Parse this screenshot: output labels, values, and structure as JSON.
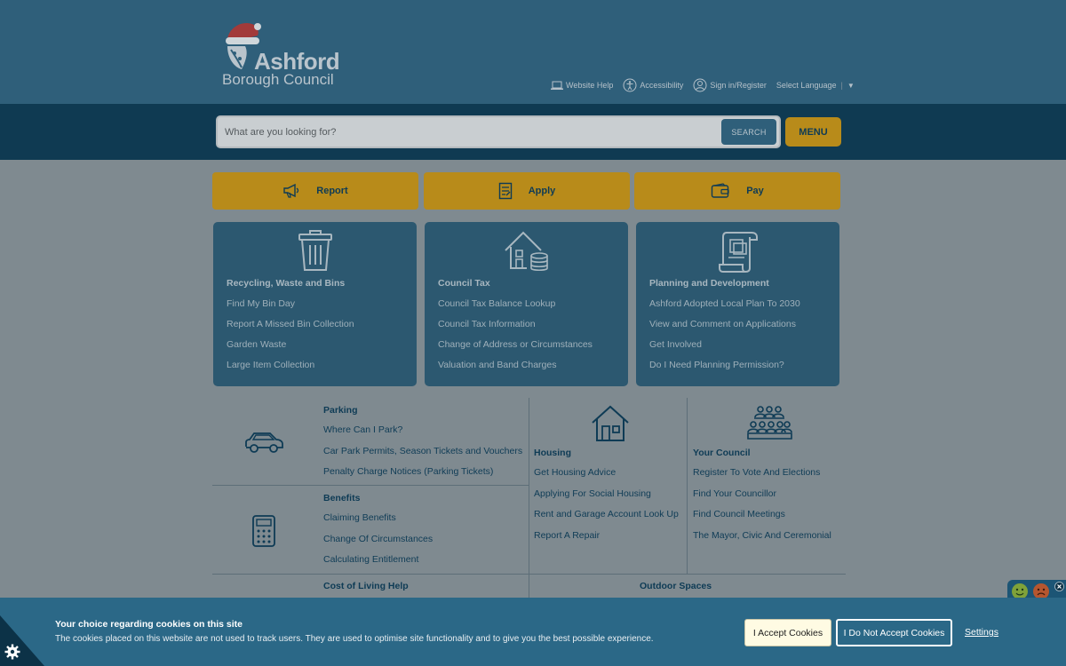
{
  "header": {
    "logo_word": "Ashford",
    "logo_sub": "Borough Council",
    "utility": {
      "help": "Website Help",
      "accessibility": "Accessibility",
      "signin": "Sign in/Register",
      "language": "Select Language",
      "language_caret": "▼"
    }
  },
  "search": {
    "placeholder": "What are you looking for?",
    "button": "SEARCH",
    "menu": "MENU"
  },
  "actions": [
    {
      "label": "Report",
      "icon": "megaphone-icon"
    },
    {
      "label": "Apply",
      "icon": "form-icon"
    },
    {
      "label": "Pay",
      "icon": "wallet-icon"
    }
  ],
  "cards": [
    {
      "title": "Recycling, Waste and Bins",
      "icon": "bin-icon",
      "links": [
        "Find My Bin Day",
        "Report A Missed Bin Collection",
        "Garden Waste",
        "Large Item Collection"
      ]
    },
    {
      "title": "Council Tax",
      "icon": "house-coins-icon",
      "links": [
        "Council Tax Balance Lookup",
        "Council Tax Information",
        "Change of Address or Circumstances",
        "Valuation and Band Charges"
      ]
    },
    {
      "title": "Planning and Development",
      "icon": "plan-scroll-icon",
      "links": [
        "Ashford Adopted Local Plan To 2030",
        "View and Comment on Applications",
        "Get Involved",
        "Do I Need Planning Permission?"
      ]
    }
  ],
  "sections": {
    "parking": {
      "title": "Parking",
      "links": [
        "Where Can I Park?",
        "Car Park Permits, Season Tickets and Vouchers",
        "Penalty Charge Notices (Parking Tickets)"
      ]
    },
    "benefits": {
      "title": "Benefits",
      "links": [
        "Claiming Benefits",
        "Change Of Circumstances",
        "Calculating Entitlement"
      ]
    },
    "housing": {
      "title": "Housing",
      "links": [
        "Get Housing Advice",
        "Applying For Social Housing",
        "Rent and Garage Account Look Up",
        "Report A Repair"
      ]
    },
    "council": {
      "title": "Your Council",
      "links": [
        "Register To Vote And Elections",
        "Find Your Councillor",
        "Find Council Meetings",
        "The Mayor, Civic And Ceremonial"
      ]
    },
    "cost_of_living": {
      "title": "Cost of Living Help"
    },
    "outdoor": {
      "title": "Outdoor Spaces"
    }
  },
  "cookie": {
    "title": "Your choice regarding cookies on this site",
    "text": "The cookies placed on this website are not used to track users. They are used to optimise site functionality and to give you the best possible experience.",
    "accept": "I Accept Cookies",
    "decline": "I Do Not Accept Cookies",
    "settings": "Settings"
  },
  "colors": {
    "header_bg": "#2f5f7a",
    "search_bg": "#0f3a52",
    "accent_gold": "#b88b1a",
    "card_bg": "#2c5870",
    "cookie_bg": "#2b6887"
  }
}
